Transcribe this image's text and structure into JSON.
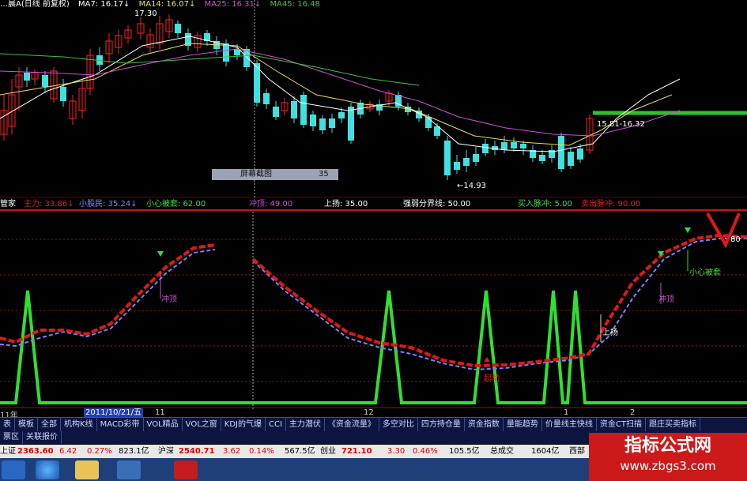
{
  "header": {
    "title": "…晨A(日线 前复权)",
    "ma": [
      {
        "label": "MA7: 16.17↓",
        "color": "#ffffff"
      },
      {
        "label": "MA14: 16.07↓",
        "color": "#e8e060"
      },
      {
        "label": "MA25: 16.31↓",
        "color": "#d050d0"
      },
      {
        "label": "MA45: 16.48",
        "color": "#40c040"
      }
    ]
  },
  "price_labels": {
    "high": "17.30",
    "low": "←14.93",
    "range": "15.81-16.32"
  },
  "tooltip": {
    "label": "屏幕截图",
    "value": "35"
  },
  "indicator_header": [
    {
      "text": "管家",
      "color": "#ffffff"
    },
    {
      "text": "主力: 33.86↓",
      "color": "#e02020"
    },
    {
      "text": "小股民: 35.24↓",
      "color": "#8080ff"
    },
    {
      "text": "小心被套: 62.00",
      "color": "#40e040"
    },
    {
      "text": "冲顶: 49.00",
      "color": "#d050d0"
    },
    {
      "text": "上扬: 35.00",
      "color": "#ffffff"
    },
    {
      "text": "强弱分界线: 50.00",
      "color": "#ffffff"
    },
    {
      "text": "买入脉冲: 5.00",
      "color": "#40e040"
    },
    {
      "text": "卖出脉冲: 90.00",
      "color": "#e02020"
    }
  ],
  "annotations": {
    "chongding1": "冲顶",
    "chongding2": "冲顶",
    "qidong": "起动",
    "shangyang": "上扬",
    "xiaoxin": "小心被套",
    "right_tag": "80"
  },
  "timeline": {
    "year": "11年",
    "date": "2011/10/21/五",
    "m1": "11",
    "m2": "12",
    "m3": "1",
    "m4": "2"
  },
  "tabs": [
    "表",
    "模板",
    "全部",
    "机构K线",
    "MACD彩带",
    "VOL精品",
    "VOL之窗",
    "KDJ的气爆",
    "CCI",
    "主力潜伏",
    "《资金流量》",
    "多空对比",
    "四方持仓量",
    "资金指数",
    "量能趋势",
    "价量线主快线",
    "资金CT扫描",
    "跟庄买卖指标"
  ],
  "tabs2": [
    "票区",
    "关联报价"
  ],
  "quotes": [
    {
      "name": "上证",
      "price": "2363.60",
      "chg": "6.42",
      "pct": "0.27%",
      "vol": "823.1亿"
    },
    {
      "name": "沪深",
      "price": "2540.71",
      "chg": "3.62",
      "pct": "0.14%",
      "vol": "567.5亿"
    },
    {
      "name": "创业",
      "price": "721.10",
      "chg": "3.30",
      "pct": "0.46%",
      "vol": "105.5亿"
    }
  ],
  "quote_extra": {
    "label": "总成交",
    "value": "1604亿",
    "region": "西部"
  },
  "watermark": {
    "title": "指标公式网",
    "url": "www.zbgs3.com"
  },
  "colors": {
    "up": "#ff2020",
    "down": "#40e0e0",
    "green": "#30e030",
    "red": "#e01818",
    "blue": "#8080ff"
  }
}
